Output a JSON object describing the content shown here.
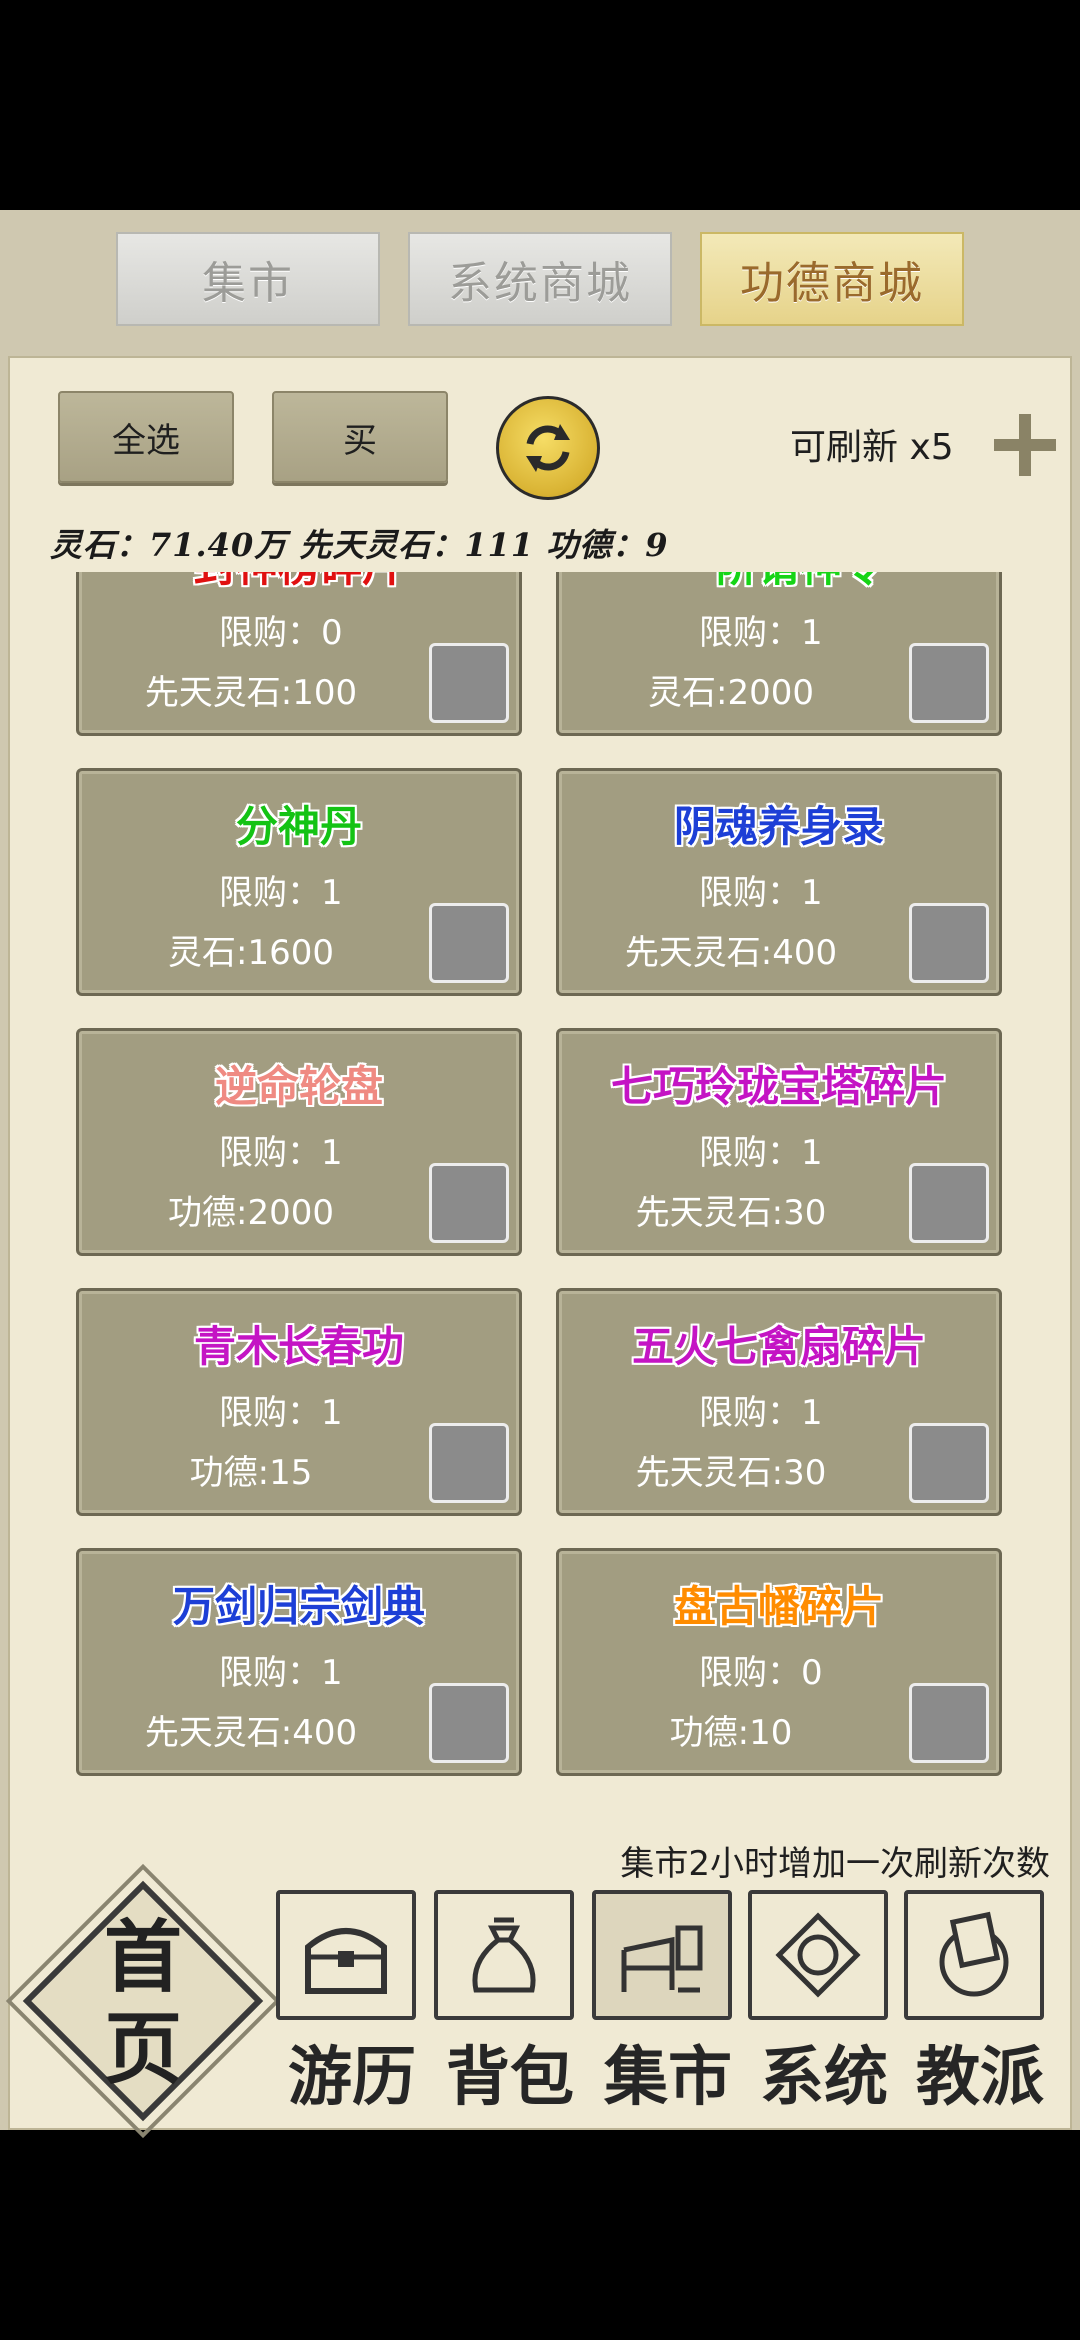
{
  "tabs": [
    {
      "label": "集市"
    },
    {
      "label": "系统商城"
    },
    {
      "label": "功德商城"
    }
  ],
  "controls": {
    "select_all": "全选",
    "buy": "买",
    "refresh_count": "可刷新 x5"
  },
  "currency": "灵石：71.40万 先天灵石：111 功德：9",
  "items": [
    {
      "name": "封神榜碎片",
      "color": "#e01010",
      "limit": "限购：0",
      "price": "先天灵石:100"
    },
    {
      "name": "一阶请神令",
      "color": "#16d416",
      "limit": "限购：1",
      "price": "灵石:2000"
    },
    {
      "name": "分神丹",
      "color": "#14c314",
      "limit": "限购：1",
      "price": "灵石:1600"
    },
    {
      "name": "阴魂养身录",
      "color": "#1d3fd6",
      "limit": "限购：1",
      "price": "先天灵石:400"
    },
    {
      "name": "逆命轮盘",
      "color": "#ef8a82",
      "limit": "限购：1",
      "price": "功德:2000"
    },
    {
      "name": "七巧玲珑宝塔碎片",
      "color": "#c414c4",
      "limit": "限购：1",
      "price": "先天灵石:30"
    },
    {
      "name": "青木长春功",
      "color": "#c414c4",
      "limit": "限购：1",
      "price": "功德:15"
    },
    {
      "name": "五火七禽扇碎片",
      "color": "#c414c4",
      "limit": "限购：1",
      "price": "先天灵石:30"
    },
    {
      "name": "万剑归宗剑典",
      "color": "#1d3fd6",
      "limit": "限购：1",
      "price": "先天灵石:400"
    },
    {
      "name": "盘古幡碎片",
      "color": "#ff8c00",
      "limit": "限购：0",
      "price": "功德:10"
    }
  ],
  "refresh_note": "集市2小时增加一次刷新次数",
  "nav": {
    "home": "首页",
    "items": [
      {
        "label": "游历",
        "icon": "chest-icon"
      },
      {
        "label": "背包",
        "icon": "bag-icon"
      },
      {
        "label": "集市",
        "icon": "market-stall-icon"
      },
      {
        "label": "系统",
        "icon": "system-seal-icon"
      },
      {
        "label": "教派",
        "icon": "sect-banner-icon"
      }
    ]
  }
}
